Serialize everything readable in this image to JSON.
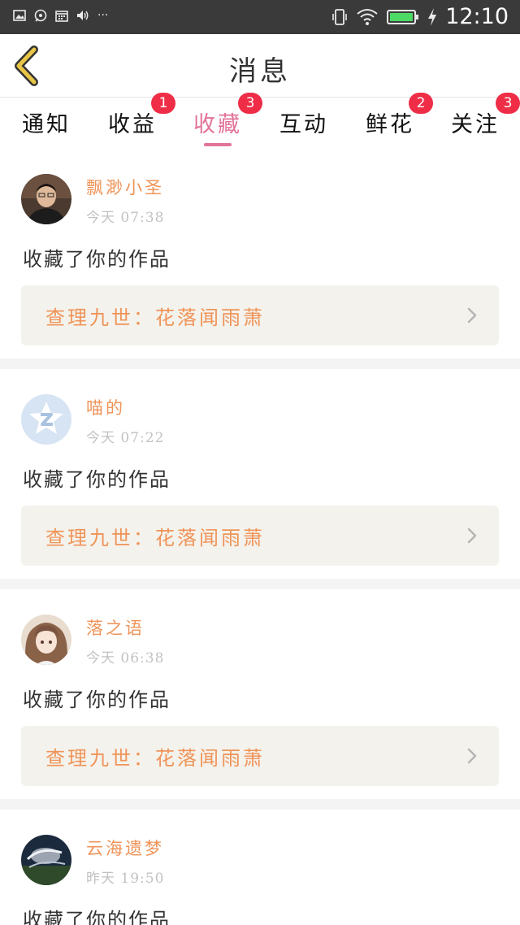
{
  "status_bar": {
    "time": "12:10",
    "left_icons": [
      "image-icon",
      "notification-icon",
      "calendar-icon",
      "volume-icon"
    ],
    "more": "···",
    "battery_color": "#4cd964"
  },
  "header": {
    "title": "消息",
    "back_icon": "chevron-left-icon",
    "back_color": "#e8c547"
  },
  "tabs": [
    {
      "label": "通知",
      "badge": ""
    },
    {
      "label": "收益",
      "badge": "1"
    },
    {
      "label": "收藏",
      "badge": "3",
      "active": true
    },
    {
      "label": "互动",
      "badge": ""
    },
    {
      "label": "鲜花",
      "badge": "2"
    },
    {
      "label": "关注",
      "badge": "3"
    }
  ],
  "colors": {
    "accent": "#e2739a",
    "badge": "#ef2d47",
    "name": "#ef9459",
    "card_bg": "#f4f2ec"
  },
  "items": [
    {
      "username": "飘渺小圣",
      "time": "今天 07:38",
      "action": "收藏了你的作品",
      "work": "查理九世：花落闻雨萧"
    },
    {
      "username": "喵的",
      "time": "今天 07:22",
      "action": "收藏了你的作品",
      "work": "查理九世：花落闻雨萧"
    },
    {
      "username": "落之语",
      "time": "今天 06:38",
      "action": "收藏了你的作品",
      "work": "查理九世：花落闻雨萧"
    },
    {
      "username": "云海遗梦",
      "time": "昨天 19:50",
      "action": "收藏了你的作品",
      "work": ""
    }
  ]
}
